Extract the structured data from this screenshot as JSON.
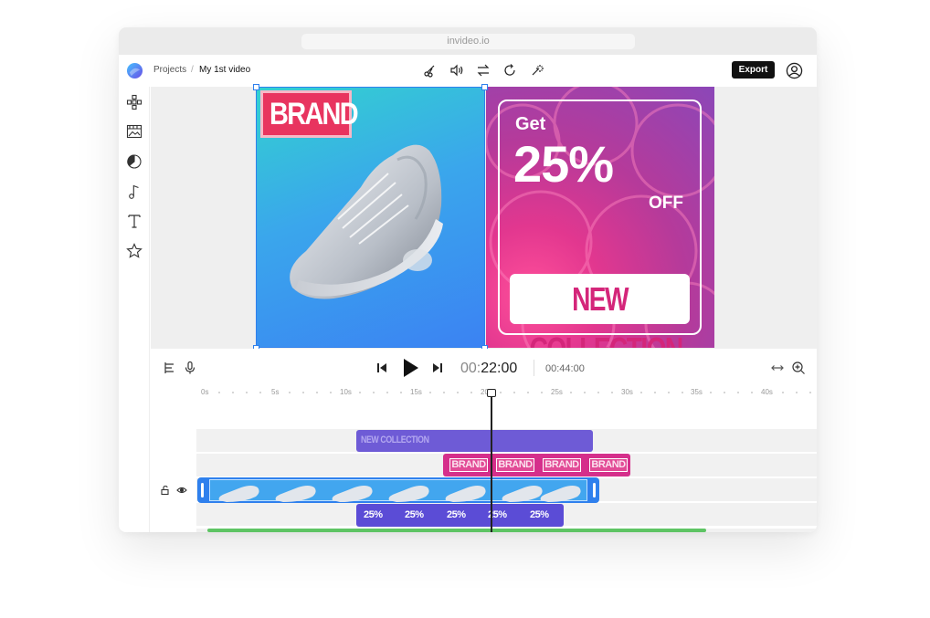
{
  "browser": {
    "url": "invideo.io"
  },
  "header": {
    "breadcrumb": {
      "projects": "Projects",
      "separator": "/",
      "current": "My 1st video"
    },
    "tools": [
      "cut-icon",
      "volume-icon",
      "swap-icon",
      "rotate-icon",
      "magic-wand-icon"
    ],
    "export_label": "Export"
  },
  "sidebar": {
    "items": [
      "layout-icon",
      "media-icon",
      "shapes-icon",
      "music-icon",
      "text-icon",
      "star-icon"
    ]
  },
  "canvas": {
    "scene1": {
      "brand": "BRAND"
    },
    "scene2": {
      "get": "Get",
      "percent": "25%",
      "off": "OFF",
      "collection": "NEW COLLECTION"
    }
  },
  "playback": {
    "current_main": "00:",
    "current_rest": "22:00",
    "total": "00:44:00"
  },
  "timeline": {
    "ruler": [
      "0s",
      "5s",
      "10s",
      "15s",
      "20s",
      "25s",
      "30s",
      "35s",
      "40s"
    ],
    "clips": {
      "collection": "NEW COLLECTION",
      "brand": [
        "BRAND",
        "BRAND",
        "BRAND",
        "BRAND"
      ],
      "percent": [
        "25%",
        "25%",
        "25%",
        "25%",
        "25%"
      ]
    },
    "colors": {
      "purple": "#6e5bd6",
      "pink": "#d52f8b",
      "blue": "#2f80ed",
      "green": "#5ec464",
      "percent": "#5b4cd6"
    }
  }
}
